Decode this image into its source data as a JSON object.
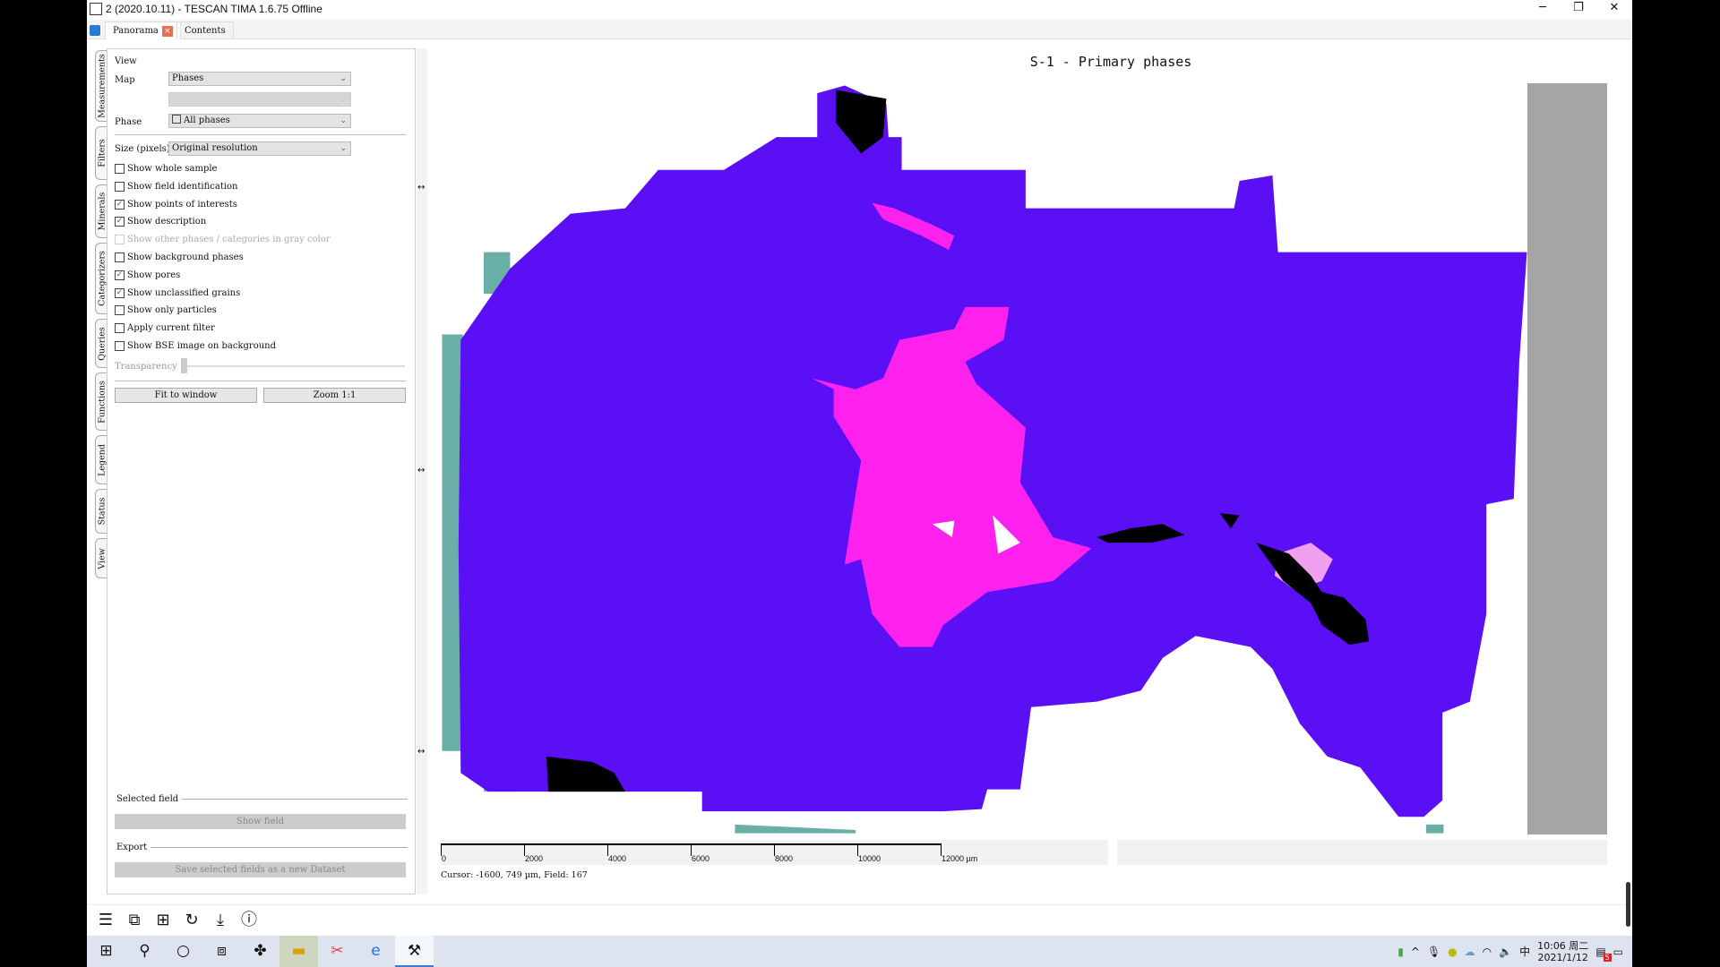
{
  "window": {
    "title": "2 (2020.10.11) - TESCAN TIMA 1.6.75 Offline",
    "minimize": "─",
    "restore": "❐",
    "close": "✕"
  },
  "tabs": [
    {
      "label": "Panorama",
      "close": "×"
    },
    {
      "label": "Contents"
    }
  ],
  "side_tabs": [
    "Measurements",
    "Filters",
    "Minerals",
    "Categorizers",
    "Queries",
    "Functions",
    "Legend",
    "Status",
    "View"
  ],
  "panel": {
    "view_label": "View",
    "map_label": "Map",
    "map_value": "Phases",
    "map_sub_value": "",
    "phase_label": "Phase",
    "phase_value": "All phases",
    "size_label": "Size (pixels)",
    "size_value": "Original resolution",
    "checkboxes": [
      {
        "label": "Show whole sample",
        "checked": false,
        "enabled": true
      },
      {
        "label": "Show field identification",
        "checked": false,
        "enabled": true
      },
      {
        "label": "Show points of interests",
        "checked": true,
        "enabled": true
      },
      {
        "label": "Show description",
        "checked": true,
        "enabled": true
      },
      {
        "label": "Show other phases / categories in gray color",
        "checked": false,
        "enabled": false
      },
      {
        "label": "Show background phases",
        "checked": false,
        "enabled": true
      },
      {
        "label": "Show pores",
        "checked": true,
        "enabled": true
      },
      {
        "label": "Show unclassified grains",
        "checked": true,
        "enabled": true
      },
      {
        "label": "Show only particles",
        "checked": false,
        "enabled": true
      },
      {
        "label": "Apply current filter",
        "checked": false,
        "enabled": true
      },
      {
        "label": "Show BSE image on background",
        "checked": false,
        "enabled": true
      }
    ],
    "transparency_label": "Transparency",
    "transparency_value": 0,
    "fit_button": "Fit to window",
    "zoom_button": "Zoom 1:1",
    "selected_field_label": "Selected field",
    "show_field_button": "Show field",
    "export_label": "Export",
    "save_button": "Save selected fields as a new Dataset"
  },
  "map": {
    "title": "S-1 - Primary phases",
    "scale_ticks": [
      "0",
      "2000",
      "4000",
      "6000",
      "8000",
      "10000",
      "12000 µm"
    ],
    "cursor_text": "Cursor: -1600, 749 µm, Field: 167",
    "colors": {
      "main_phase": "#5a0ff5",
      "secondary_phase": "#ff22ee",
      "background": "#6aaea8",
      "pores": "#000000",
      "light_phase": "#f0a0f0"
    }
  },
  "toolbar_icons": [
    "menu-icon",
    "layers-icon",
    "panel-icon",
    "refresh-icon",
    "download-icon",
    "help-icon"
  ],
  "taskbar": {
    "time": "10:06 周二",
    "date": "2021/1/12",
    "ime": "中",
    "badge": "5"
  }
}
